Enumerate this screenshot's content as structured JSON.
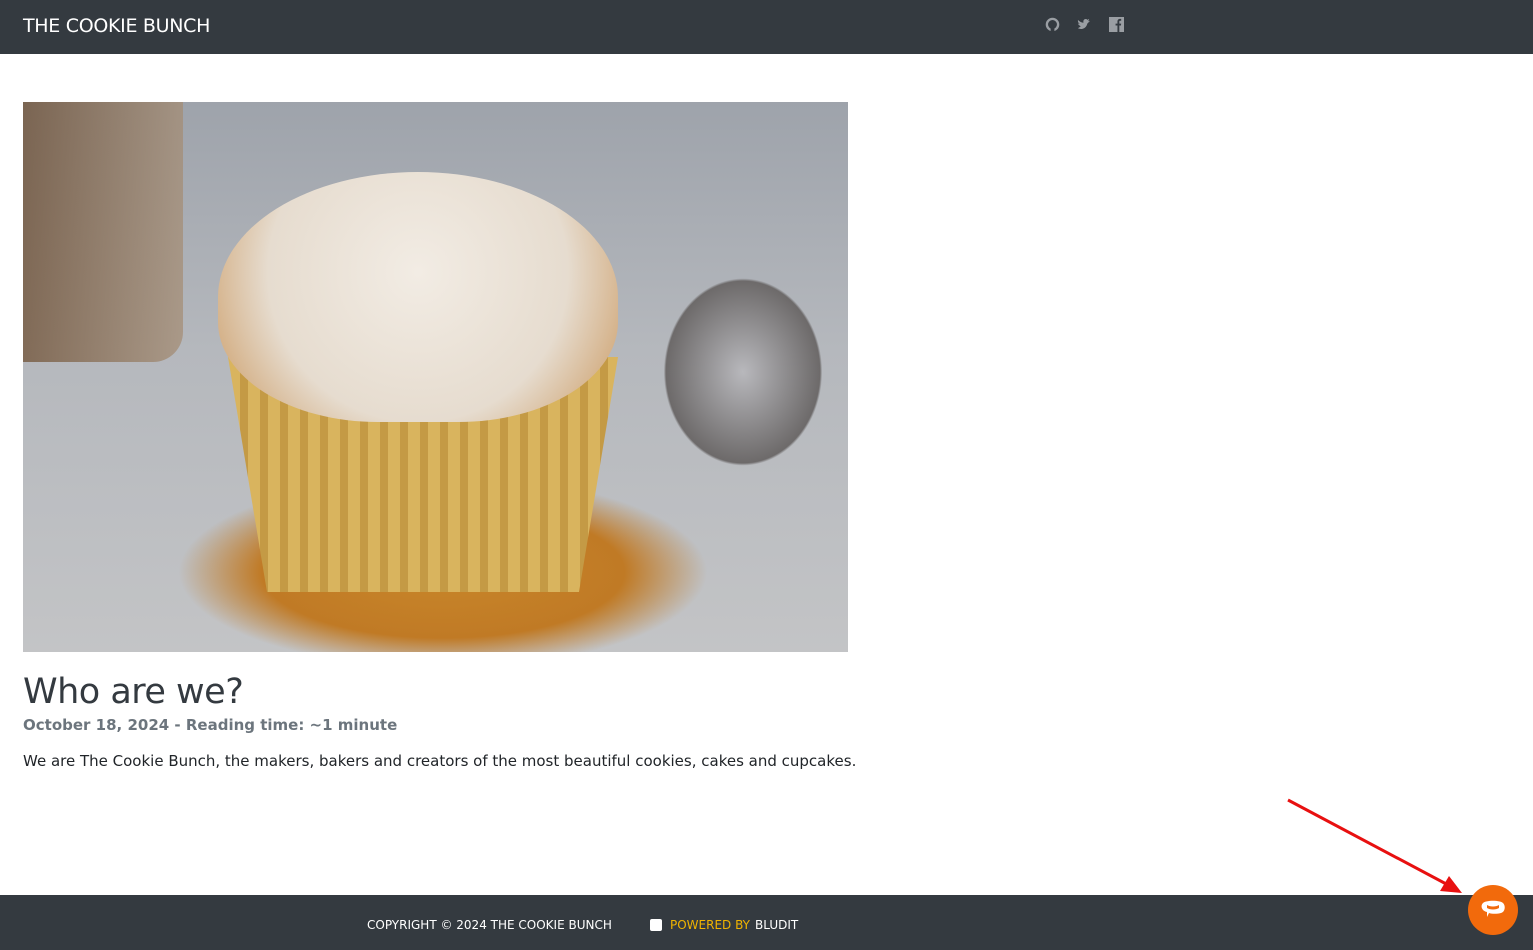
{
  "header": {
    "brand": "THE COOKIE BUNCH",
    "social": [
      "github-icon",
      "twitter-icon",
      "facebook-icon"
    ]
  },
  "post": {
    "title": "Who are we?",
    "meta": "October 18, 2024 - Reading time: ~1 minute",
    "body": "We are The Cookie Bunch, the makers, bakers and creators of the most beautiful cookies, cakes and cupcakes."
  },
  "footer": {
    "copyright": "COPYRIGHT © 2024 THE COOKIE BUNCH",
    "powered": "POWERED BY",
    "bludit": "BLUDIT"
  },
  "colors": {
    "nav": "#343a40",
    "chat": "#f26a0c",
    "accent": "#f0b400"
  }
}
